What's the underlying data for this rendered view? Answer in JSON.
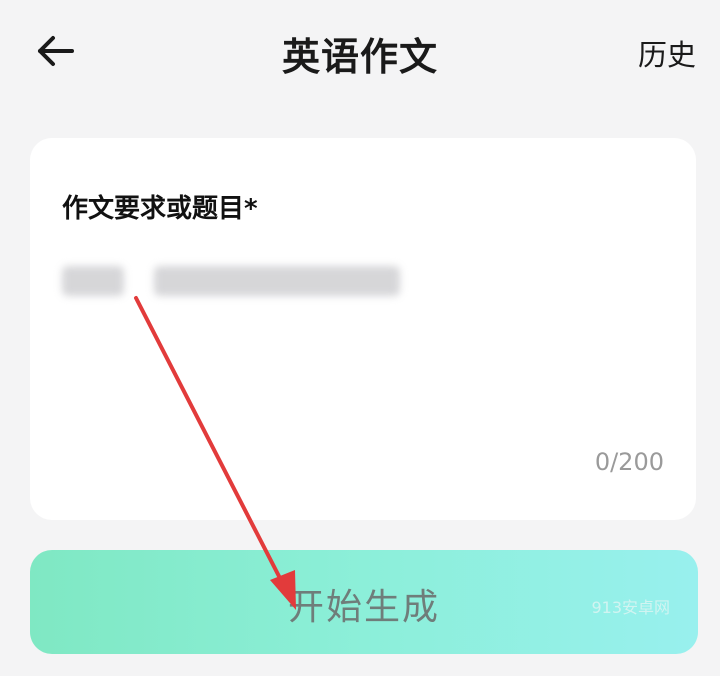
{
  "header": {
    "title": "英语作文",
    "history_label": "历史",
    "back_icon": "arrow-left-icon"
  },
  "form": {
    "field_label": "作文要求或题目",
    "required_mark": "*",
    "counter": "0/200"
  },
  "generate_button": {
    "label": "开始生成",
    "watermark": "913安卓网"
  },
  "colors": {
    "background": "#f4f4f5",
    "card": "#ffffff",
    "button_gradient_start": "#7fe8c3",
    "button_gradient_end": "#98f0ee",
    "annotation_arrow": "#e23b3b"
  }
}
